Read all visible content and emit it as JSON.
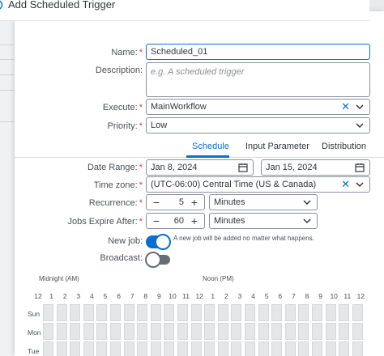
{
  "dialog": {
    "title": "Add Scheduled Trigger"
  },
  "form": {
    "name": {
      "label": "Name:",
      "value": "Scheduled_01"
    },
    "description": {
      "label": "Description:",
      "placeholder": "e.g.  A scheduled trigger"
    },
    "execute": {
      "label": "Execute:",
      "value": "MainWorkflow"
    },
    "priority": {
      "label": "Priority:",
      "value": "Low"
    }
  },
  "tabs": [
    "Schedule",
    "Input Parameter",
    "Distribution"
  ],
  "schedule": {
    "date_range": {
      "label": "Date Range:",
      "start": "Jan 8, 2024",
      "end": "Jan 15, 2024"
    },
    "time_zone": {
      "label": "Time zone:",
      "value": "(UTC-06:00)  Central Time (US & Canada)"
    },
    "recurrence": {
      "label": "Recurrence:",
      "value": "5",
      "unit": "Minutes"
    },
    "jobs_expire": {
      "label": "Jobs Expire After:",
      "value": "60",
      "unit": "Minutes"
    },
    "new_job": {
      "label": "New job:",
      "hint": "A new job will be added no matter what happens.",
      "on": true
    },
    "broadcast": {
      "label": "Broadcast:",
      "on": false
    },
    "grid": {
      "midnight_label": "Midnight (AM)",
      "noon_label": "Noon (PM)",
      "hours": [
        "12",
        "1",
        "2",
        "3",
        "4",
        "5",
        "6",
        "7",
        "8",
        "9",
        "10",
        "11",
        "12",
        "1",
        "2",
        "3",
        "4",
        "5",
        "6",
        "7",
        "8",
        "9",
        "10",
        "11",
        "12"
      ],
      "days": [
        "Sun",
        "Mon",
        "Tue"
      ]
    }
  },
  "icons": {
    "stepper_minus": "−",
    "stepper_plus": "+",
    "clear": "✕"
  },
  "colors": {
    "accent": "#0a6ed1",
    "required": "#d9364c"
  }
}
